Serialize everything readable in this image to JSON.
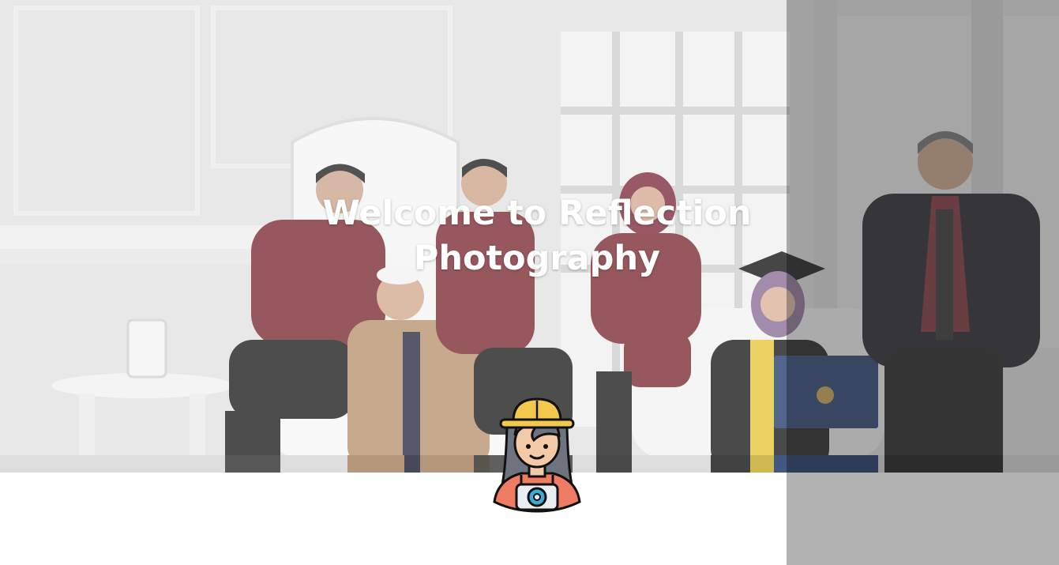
{
  "hero": {
    "title": "Welcome to Reflection Photography"
  },
  "logo": {
    "icon": "photographer-avatar-icon"
  },
  "colors": {
    "shirt": "#7a2a30",
    "overlay": "#000000",
    "hat": "#f2c94c",
    "hair": "#6d7480",
    "camera_strap": "#f07b63",
    "camera_lens": "#3fa9d6",
    "diploma": "#223a6b"
  }
}
